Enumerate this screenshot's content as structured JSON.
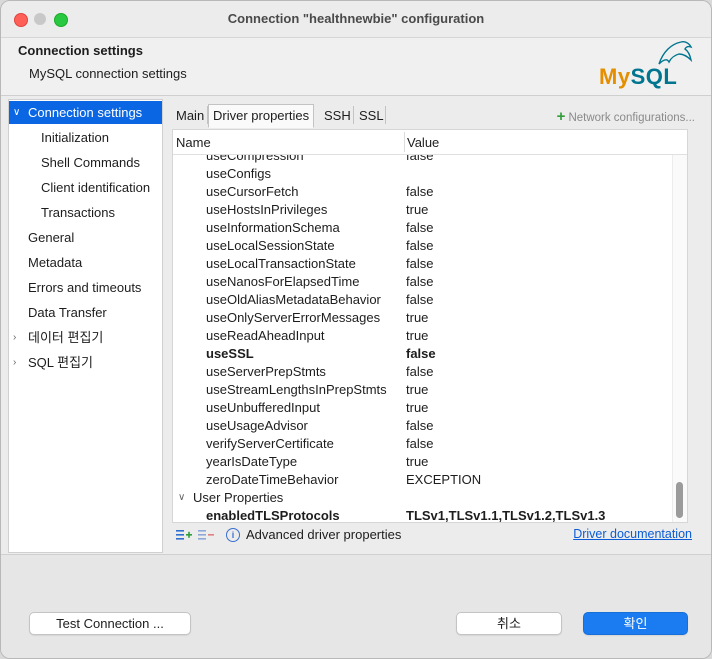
{
  "window": {
    "title": "Connection \"healthnewbie\" configuration"
  },
  "header": {
    "title": "Connection settings",
    "subtitle": "MySQL connection settings",
    "logo_text_a": "My",
    "logo_text_b": "SQL"
  },
  "sidebar": {
    "items": [
      {
        "label": "Connection settings",
        "caret": "∨"
      },
      {
        "label": "Initialization"
      },
      {
        "label": "Shell Commands"
      },
      {
        "label": "Client identification"
      },
      {
        "label": "Transactions"
      },
      {
        "label": "General"
      },
      {
        "label": "Metadata"
      },
      {
        "label": "Errors and timeouts"
      },
      {
        "label": "Data Transfer"
      },
      {
        "label": "데이터 편집기",
        "caret": "›"
      },
      {
        "label": "SQL 편집기",
        "caret": "›"
      }
    ]
  },
  "tabs": [
    "Main",
    "Driver properties",
    "SSH",
    "SSL"
  ],
  "network_config": "Network configurations...",
  "table": {
    "col_name": "Name",
    "col_value": "Value",
    "rows": [
      {
        "name": "useCompression",
        "value": "false"
      },
      {
        "name": "useConfigs",
        "value": ""
      },
      {
        "name": "useCursorFetch",
        "value": "false"
      },
      {
        "name": "useHostsInPrivileges",
        "value": "true"
      },
      {
        "name": "useInformationSchema",
        "value": "false"
      },
      {
        "name": "useLocalSessionState",
        "value": "false"
      },
      {
        "name": "useLocalTransactionState",
        "value": "false"
      },
      {
        "name": "useNanosForElapsedTime",
        "value": "false"
      },
      {
        "name": "useOldAliasMetadataBehavior",
        "value": "false"
      },
      {
        "name": "useOnlyServerErrorMessages",
        "value": "true"
      },
      {
        "name": "useReadAheadInput",
        "value": "true"
      },
      {
        "name": "useSSL",
        "value": "false"
      },
      {
        "name": "useServerPrepStmts",
        "value": "false"
      },
      {
        "name": "useStreamLengthsInPrepStmts",
        "value": "true"
      },
      {
        "name": "useUnbufferedInput",
        "value": "true"
      },
      {
        "name": "useUsageAdvisor",
        "value": "false"
      },
      {
        "name": "verifyServerCertificate",
        "value": "false"
      },
      {
        "name": "yearIsDateType",
        "value": "true"
      },
      {
        "name": "zeroDateTimeBehavior",
        "value": "EXCEPTION"
      },
      {
        "name": "User Properties",
        "value": ""
      },
      {
        "name": "enabledTLSProtocols",
        "value": "TLSv1,TLSv1.1,TLSv1.2,TLSv1.3"
      }
    ]
  },
  "bottom": {
    "advanced_label": "Advanced driver properties",
    "doc_link": "Driver documentation"
  },
  "footer": {
    "test_button": "Test Connection ...",
    "cancel_button": "취소",
    "ok_button": "확인"
  }
}
